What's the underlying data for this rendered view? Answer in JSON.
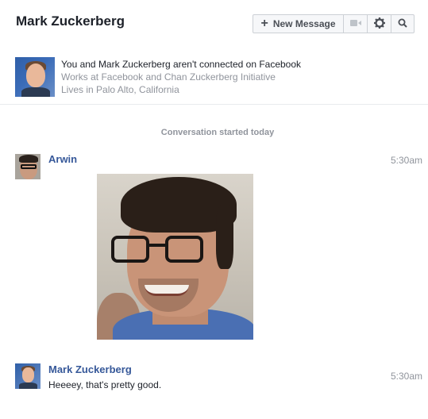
{
  "header": {
    "title": "Mark Zuckerberg",
    "new_message_label": "New Message"
  },
  "profile": {
    "connection_text": "You and Mark Zuckerberg aren't connected on Facebook",
    "work_text": "Works at Facebook and Chan Zuckerberg Initiative",
    "location_text": "Lives in Palo Alto, California"
  },
  "conversation": {
    "started_text": "Conversation started today",
    "messages": [
      {
        "sender": "Arwin",
        "time": "5:30am"
      },
      {
        "sender": "Mark Zuckerberg",
        "time": "5:30am",
        "text": "Heeeey, that's pretty good."
      }
    ]
  },
  "icons": {
    "new_message": "plus-icon",
    "video": "video-camera-icon",
    "settings": "gear-icon",
    "search": "search-icon"
  },
  "colors": {
    "link_blue": "#365899",
    "muted_gray": "#90949c",
    "border": "#ccd0d5"
  }
}
